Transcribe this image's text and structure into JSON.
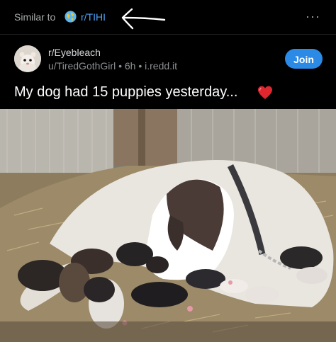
{
  "header": {
    "similar_label": "Similar to",
    "subreddit_link": "r/TIHI",
    "more_label": "···"
  },
  "post": {
    "community": "r/Eyebleach",
    "author": "u/TiredGothGirl",
    "separator": "•",
    "age": "6h",
    "domain": "i.redd.it",
    "join_label": "Join",
    "title": "My dog had 15 puppies yesterday...",
    "title_emoji": "red-heart-emoji"
  },
  "colors": {
    "background": "#000000",
    "link_blue": "#4fa3f7",
    "join_button": "#2a8ae6",
    "muted_text": "#8c8f91",
    "heart": "#e0262f"
  }
}
